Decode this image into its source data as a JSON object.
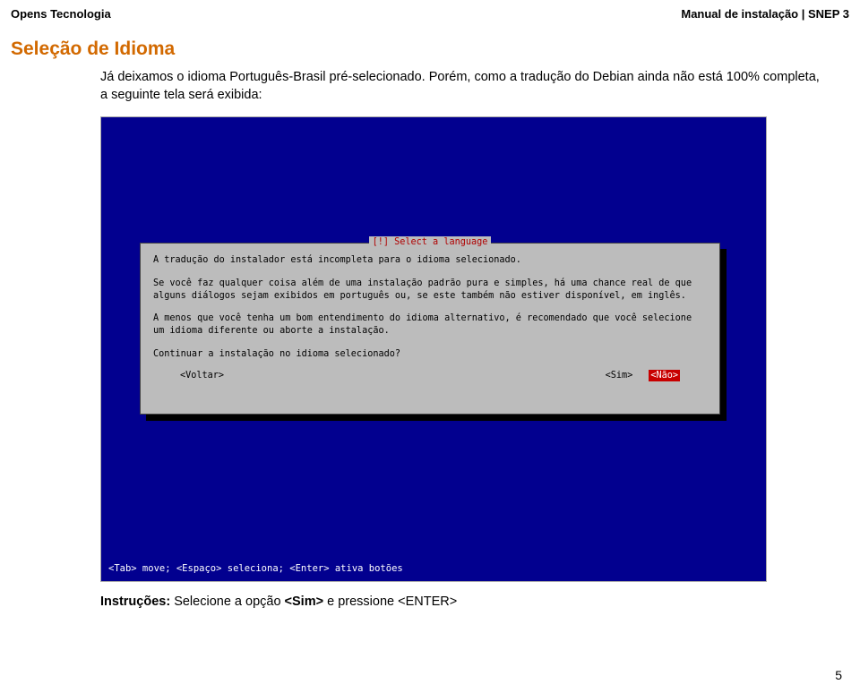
{
  "header": {
    "left": "Opens Tecnologia",
    "right": "Manual de instalação | SNEP 3"
  },
  "section": {
    "title": "Seleção de Idioma",
    "paragraph": "Já deixamos o idioma Português-Brasil pré-selecionado. Porém, como a tradução do Debian ainda não está 100% completa, a seguinte tela será exibida:"
  },
  "dialog": {
    "title": "[!] Select a language",
    "line1": "A tradução do instalador está incompleta para o idioma selecionado.",
    "line2": "Se você faz qualquer coisa além de uma instalação padrão pura e simples, há uma chance real de que alguns diálogos sejam exibidos em português ou, se este também não estiver disponível, em inglês.",
    "line3": "A menos que você tenha um bom entendimento do idioma alternativo, é recomendado que você selecione um idioma diferente ou aborte a instalação.",
    "line4": "Continuar a instalação no idioma selecionado?",
    "btn_back": "<Voltar>",
    "btn_yes": "<Sim>",
    "btn_no": "<Não>"
  },
  "statusbar": "<Tab> move; <Espaço> seleciona; <Enter> ativa botões",
  "instructions": {
    "label": "Instruções:",
    "text": " Selecione a opção ",
    "sim": "<Sim>",
    "text2": " e pressione ",
    "enter": "<ENTER>"
  },
  "page_number": "5"
}
